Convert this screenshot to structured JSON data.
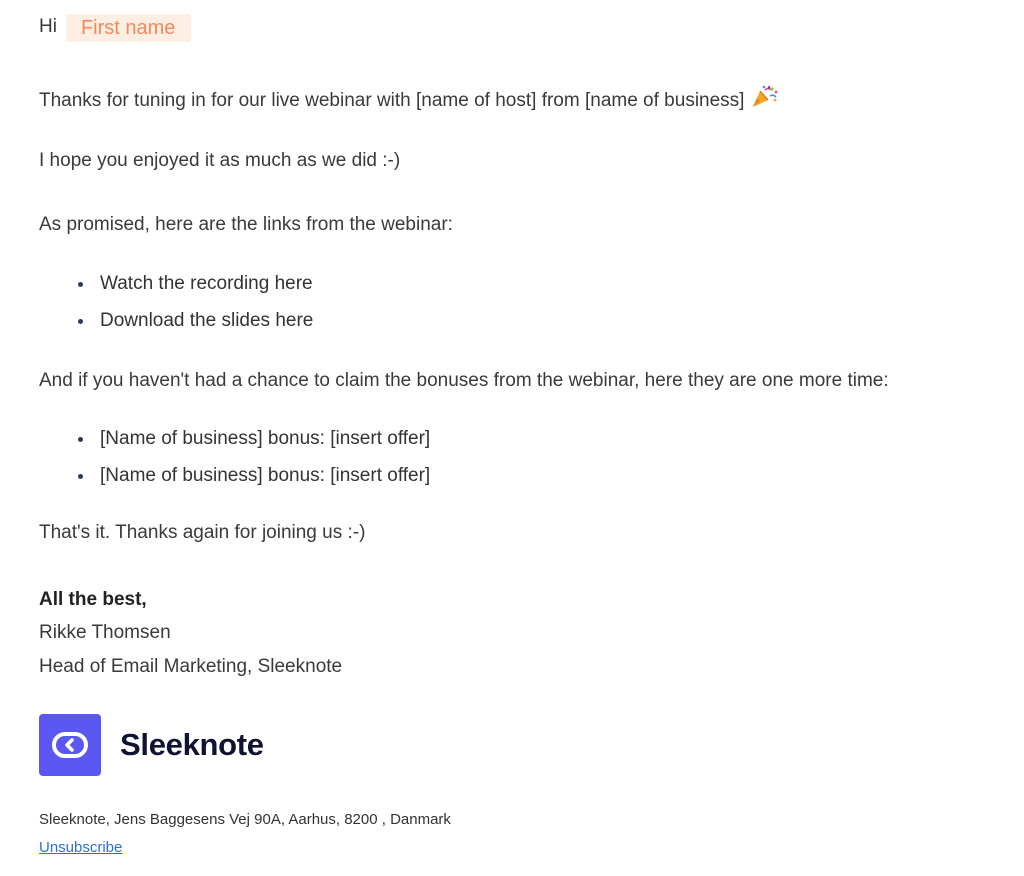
{
  "greeting": {
    "hi": "Hi",
    "merge_tag": "First name"
  },
  "body": {
    "intro": "Thanks for tuning in for our live webinar with [name of host] from [name of business]",
    "intro_emoji": "party-popper-icon",
    "hope": "I hope you enjoyed it as much as we did :-)",
    "links_intro": "As promised, here are the links from the webinar:",
    "links": [
      "Watch the recording here",
      "Download the slides here"
    ],
    "bonuses_intro": "And if you haven't had a chance to claim the bonuses from the webinar, here they are one more time:",
    "bonuses": [
      "[Name of business] bonus: [insert offer]",
      "[Name of business] bonus: [insert offer]"
    ],
    "closing": "That's it. Thanks again for joining us :-)"
  },
  "signature": {
    "signoff": "All the best,",
    "name": "Rikke Thomsen",
    "title": "Head of Email Marketing, Sleeknote"
  },
  "brand": {
    "logo_text": "Sleeknote",
    "logo_icon": "sleeknote-logo-icon",
    "color": "#5a58f0"
  },
  "footer": {
    "address": "Sleeknote, Jens Baggesens Vej 90A, Aarhus, 8200 , Danmark",
    "unsubscribe": "Unsubscribe"
  }
}
